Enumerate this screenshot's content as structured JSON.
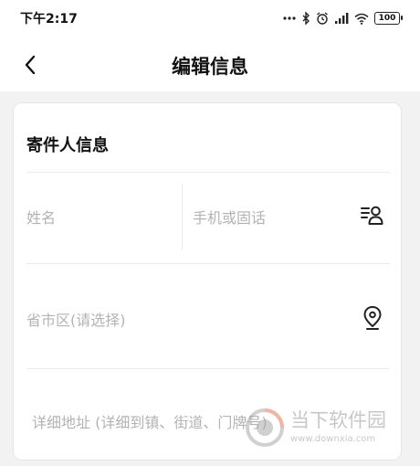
{
  "status_bar": {
    "time": "下午2:17",
    "battery": "100"
  },
  "header": {
    "title": "编辑信息"
  },
  "sender_section": {
    "title": "寄件人信息",
    "name_placeholder": "姓名",
    "phone_placeholder": "手机或固话",
    "region_placeholder": "省市区(请选择)",
    "address_placeholder": "详细地址 (详细到镇、街道、门牌号)"
  },
  "watermark": {
    "brand": "当下软件园",
    "url": "www.downxia.com"
  },
  "colors": {
    "background": "#f2f2f2",
    "card": "#ffffff",
    "placeholder": "#b3b3b3",
    "divider": "#ebebeb"
  },
  "icons": {
    "back": "chevron-left-icon",
    "contacts": "contact-book-icon",
    "location": "location-pin-icon"
  }
}
